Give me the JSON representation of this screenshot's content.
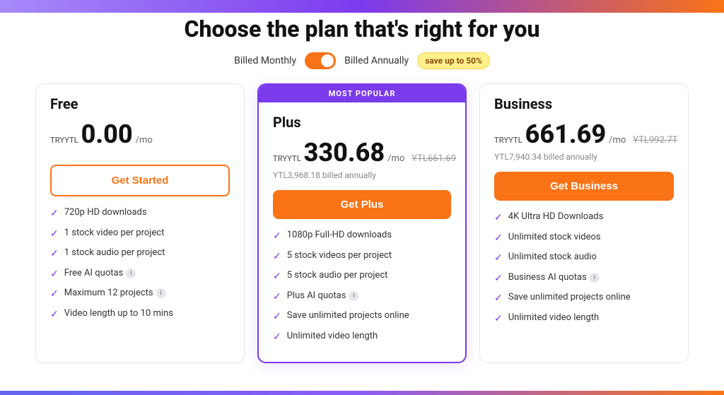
{
  "page": {
    "title": "Choose the plan that's right for you",
    "billing": {
      "monthly_label": "Billed Monthly",
      "annually_label": "Billed Annually",
      "save_badge": "save up to 50%"
    },
    "plans": [
      {
        "id": "free",
        "name": "Free",
        "price_prefix": "TRYYTL",
        "price": "0.00",
        "price_mo": "/mo",
        "price_original": null,
        "billed_info": null,
        "button_label": "Get Started",
        "button_type": "free",
        "popular": false,
        "popular_label": null,
        "features": [
          {
            "text": "720p HD downloads",
            "has_info": false
          },
          {
            "text": "1 stock video per project",
            "has_info": false
          },
          {
            "text": "1 stock audio per project",
            "has_info": false
          },
          {
            "text": "Free AI quotas",
            "has_info": true
          },
          {
            "text": "Maximum 12 projects",
            "has_info": true
          },
          {
            "text": "Video length up to 10 mins",
            "has_info": false
          }
        ]
      },
      {
        "id": "plus",
        "name": "Plus",
        "price_prefix": "TRYYTL",
        "price": "330.68",
        "price_mo": "/mo",
        "price_original": "YTL661.69",
        "billed_info": "YTL3,968.18 billed annually",
        "button_label": "Get Plus",
        "button_type": "paid",
        "popular": true,
        "popular_label": "MOST POPULAR",
        "features": [
          {
            "text": "1080p Full-HD downloads",
            "has_info": false
          },
          {
            "text": "5 stock videos per project",
            "has_info": false
          },
          {
            "text": "5 stock audio per project",
            "has_info": false
          },
          {
            "text": "Plus AI quotas",
            "has_info": true
          },
          {
            "text": "Save unlimited projects online",
            "has_info": false
          },
          {
            "text": "Unlimited video length",
            "has_info": false
          }
        ]
      },
      {
        "id": "business",
        "name": "Business",
        "price_prefix": "TRYYTL",
        "price": "661.69",
        "price_mo": "/mo",
        "price_original": "YTL992.7T",
        "billed_info": "YTL7,940.34 billed annually",
        "button_label": "Get Business",
        "button_type": "paid",
        "popular": false,
        "popular_label": null,
        "features": [
          {
            "text": "4K Ultra HD Downloads",
            "has_info": false
          },
          {
            "text": "Unlimited stock videos",
            "has_info": false
          },
          {
            "text": "Unlimited stock audio",
            "has_info": false
          },
          {
            "text": "Business AI quotas",
            "has_info": true
          },
          {
            "text": "Save unlimited projects online",
            "has_info": false
          },
          {
            "text": "Unlimited video length",
            "has_info": false
          }
        ]
      }
    ]
  }
}
